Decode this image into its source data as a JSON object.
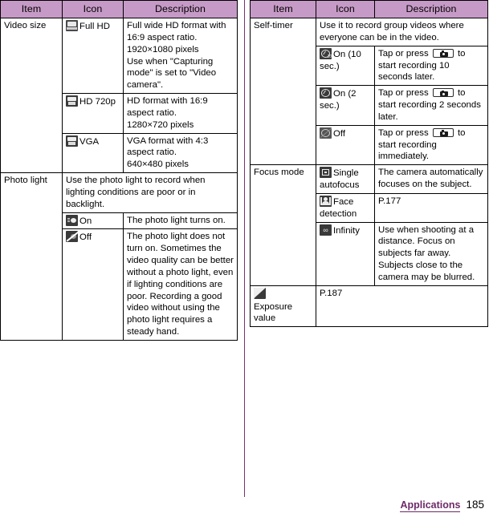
{
  "colors": {
    "header_bg": "#c69ac6",
    "divider": "#7a2f72",
    "chapter_accent": "#6d2a68",
    "border": "#000000"
  },
  "left_table": {
    "headers": [
      "Item",
      "Icon",
      "Description"
    ],
    "rows": [
      {
        "item": "Video size",
        "icon_name": "fullhd-icon",
        "icon_label": "Full HD",
        "description": "Full wide HD format with 16:9 aspect ratio.\n1920×1080 pixels\nUse when \"Capturing mode\" is set to \"Video camera\"."
      },
      {
        "item": "",
        "icon_name": "hd720p-icon",
        "icon_label": "HD 720p",
        "description": "HD format with 16:9 aspect ratio.\n1280×720 pixels"
      },
      {
        "item": "",
        "icon_name": "vga-icon",
        "icon_label": "VGA",
        "description": "VGA format with 4:3 aspect ratio.\n640×480 pixels"
      },
      {
        "item": "Photo light",
        "icon_name": "",
        "icon_label": "",
        "description": "Use the photo light to record when lighting conditions are poor or in backlight.",
        "span": "merged"
      },
      {
        "item": "",
        "icon_name": "photo-light-on-icon",
        "icon_label": "On",
        "description": "The photo light turns on."
      },
      {
        "item": "",
        "icon_name": "photo-light-off-icon",
        "icon_label": "Off",
        "description": "The photo light does not turn on. Sometimes the video quality can be better without a photo light, even if lighting conditions are poor. Recording a good video without using the photo light requires a steady hand."
      }
    ]
  },
  "right_table": {
    "headers": [
      "Item",
      "Icon",
      "Description"
    ],
    "rows": [
      {
        "item": "Self-timer",
        "icon_name": "",
        "icon_label": "",
        "description": "Use it to record group videos where everyone can be in the video.",
        "span": "merged"
      },
      {
        "item": "",
        "icon_name": "self-timer-10sec-icon",
        "icon_label": "On (10 sec.)",
        "description_pre": "Tap or press ",
        "description_key": "shutter-key-icon",
        "description_post": " to start recording 10 seconds later."
      },
      {
        "item": "",
        "icon_name": "self-timer-2sec-icon",
        "icon_label": "On (2 sec.)",
        "description_pre": "Tap or press ",
        "description_key": "shutter-key-icon",
        "description_post": " to start recording 2 seconds later."
      },
      {
        "item": "",
        "icon_name": "self-timer-off-icon",
        "icon_label": "Off",
        "description_pre": "Tap or press ",
        "description_key": "shutter-key-icon",
        "description_post": " to start recording immediately."
      },
      {
        "item": "Focus mode",
        "icon_name": "single-autofocus-icon",
        "icon_label": "Single autofocus",
        "description": "The camera automatically focuses on the subject."
      },
      {
        "item": "",
        "icon_name": "face-detection-icon",
        "icon_label": "Face detection",
        "description": "P.177"
      },
      {
        "item": "",
        "icon_name": "infinity-icon",
        "icon_label": "Infinity",
        "description": "Use when shooting at a distance. Focus on subjects far away. Subjects close to the camera may be blurred."
      },
      {
        "item_icon_name": "exposure-value-icon",
        "item": "Exposure value",
        "icon_name": "",
        "icon_label": "",
        "description": "P.187",
        "span": "merged"
      }
    ]
  },
  "footer": {
    "chapter": "Applications",
    "page_number": "185"
  }
}
